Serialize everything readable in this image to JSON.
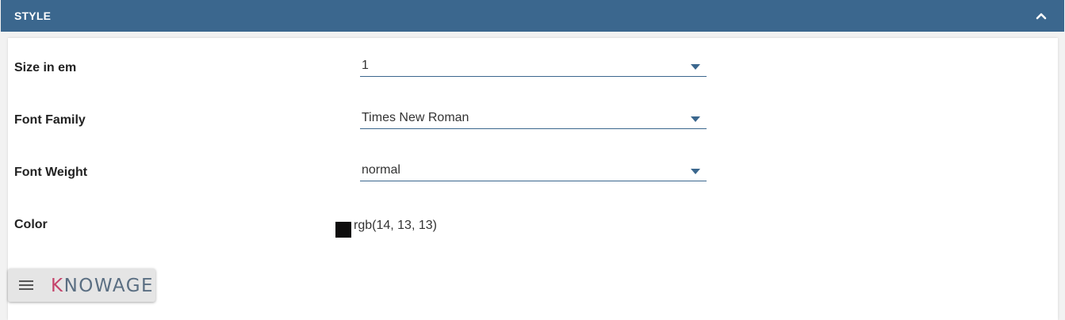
{
  "header": {
    "title": "STYLE",
    "toggle_icon": "chevron-up-icon"
  },
  "fields": {
    "size": {
      "label": "Size in em",
      "value": "1"
    },
    "font_family": {
      "label": "Font Family",
      "value": "Times New Roman"
    },
    "font_weight": {
      "label": "Font Weight",
      "value": "normal"
    },
    "color": {
      "label": "Color",
      "value": "rgb(14, 13, 13)",
      "swatch": "#0e0d0d"
    }
  },
  "footer": {
    "menu_icon": "hamburger-menu-icon",
    "logo_k": "K",
    "logo_rest": "NOWAGE"
  },
  "colors": {
    "header_bg": "#3b678e",
    "accent": "#3b678e",
    "logo_accent": "#c5436b"
  }
}
